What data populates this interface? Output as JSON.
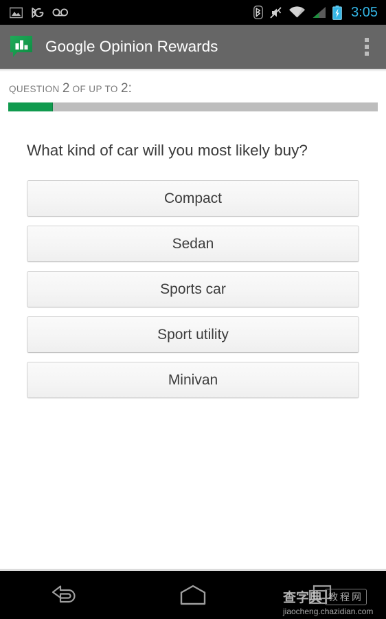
{
  "status_bar": {
    "left_icons": [
      {
        "name": "screenshot-icon",
        "label": "screenshot"
      },
      {
        "name": "bluetooth-sync-icon",
        "label": "bluetooth-google-sync"
      },
      {
        "name": "voicemail-icon",
        "label": "voicemail"
      }
    ],
    "right_icons": [
      {
        "name": "bluetooth-icon",
        "label": "bluetooth"
      },
      {
        "name": "mute-icon",
        "label": "silent-mode"
      },
      {
        "name": "wifi-icon",
        "label": "wifi"
      },
      {
        "name": "cellular-signal-icon",
        "label": "cellular-signal"
      },
      {
        "name": "battery-charging-icon",
        "label": "battery-charging"
      }
    ],
    "time": "3:05",
    "time_color": "#33b5e5",
    "background": "#000000"
  },
  "action_bar": {
    "title": "Google Opinion Rewards",
    "app_icon": "opinion-rewards-speech-bubble-chart-icon",
    "overflow_label": "More options",
    "background": "#666666",
    "brand_green": "#109a4e"
  },
  "progress": {
    "counter_prefix": "QUESTION",
    "current": "2",
    "middle_text": "OF UP TO",
    "total": "2",
    "suffix": ":",
    "percent": 12,
    "fill_color": "#109a4e",
    "track_color": "#bdbdbd"
  },
  "survey": {
    "question": "What kind of car will you most likely buy?",
    "options": [
      {
        "label": "Compact"
      },
      {
        "label": "Sedan"
      },
      {
        "label": "Sports car"
      },
      {
        "label": "Sport utility"
      },
      {
        "label": "Minivan"
      }
    ]
  },
  "nav_bar": {
    "buttons": [
      {
        "name": "back-button",
        "label": "Back"
      },
      {
        "name": "home-button",
        "label": "Home"
      },
      {
        "name": "recents-button",
        "label": "Recent apps"
      }
    ],
    "background": "#000000"
  },
  "watermark": {
    "brand_cn": "查字典",
    "boxed_cn": "教程网",
    "url": "jiaocheng.chazidian.com"
  }
}
